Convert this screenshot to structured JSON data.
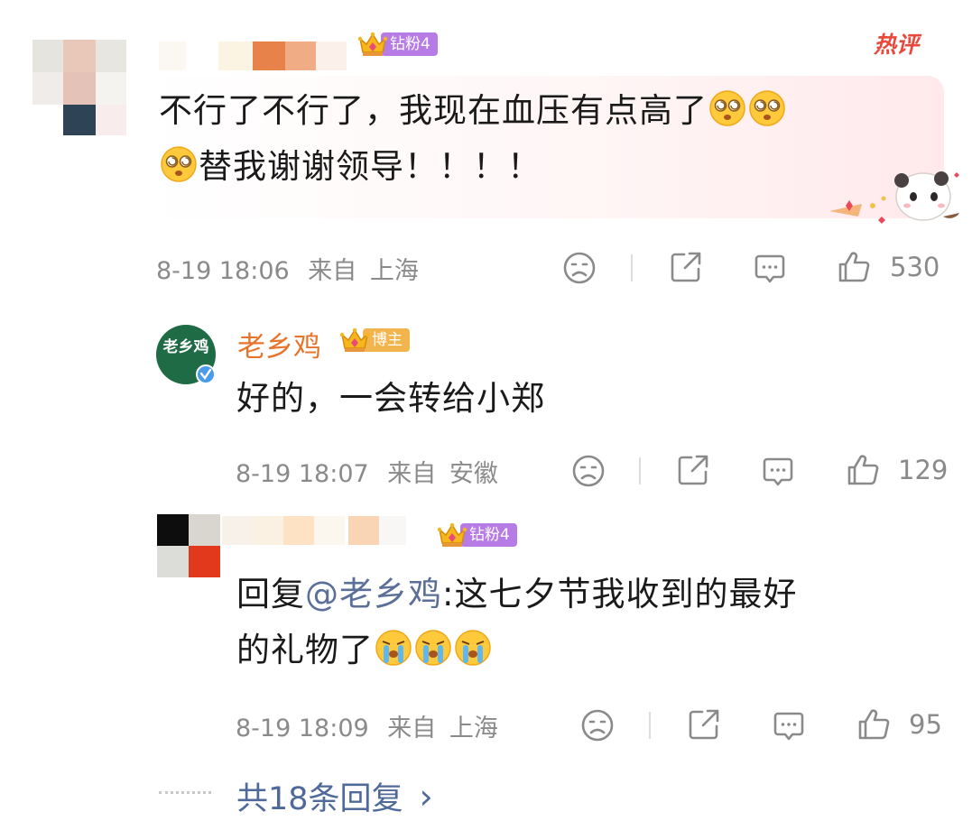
{
  "badges": {
    "fan_label": "钻粉4",
    "author_label": "博主"
  },
  "hot_tag": "热评",
  "comments": [
    {
      "text_line1": "不行了不行了，我现在血压有点高了",
      "text_line2": "替我谢谢领导！！！！",
      "date": "8-19 18:06",
      "from": "来自",
      "location": "上海",
      "likes": "530"
    }
  ],
  "reply1": {
    "avatar_text_top": "老乡",
    "avatar_text_bottom": "鸡",
    "username": "老乡鸡",
    "text": "好的，一会转给小郑",
    "date": "8-19 18:07",
    "from": "来自",
    "location": "安徽",
    "likes": "129"
  },
  "reply2": {
    "prefix": "回复",
    "mention": "@老乡鸡",
    "text_line1": ":这七夕节我收到的最好",
    "text_line2": "的礼物了",
    "date": "8-19 18:09",
    "from": "来自",
    "location": "上海",
    "likes": "95"
  },
  "more_replies": {
    "label": "共18条回复",
    "arrow": "›"
  },
  "icons": [
    "dislike-face-icon",
    "share-icon",
    "comment-icon",
    "thumbs-up-icon",
    "crown-icon",
    "chevron-right-icon"
  ],
  "colors": {
    "username_orange": "#e8742c",
    "fan_badge": "#b77be6",
    "author_badge": "#f2b54e",
    "hot_tag": "#e8493b",
    "meta_gray": "#8a8a8a",
    "avatar_green": "#1f6b45"
  }
}
